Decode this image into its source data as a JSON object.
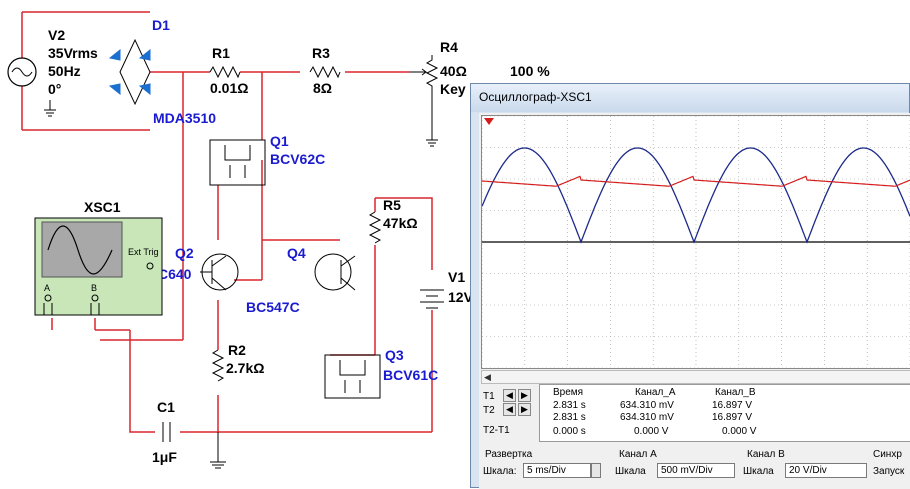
{
  "schematic": {
    "v2": {
      "name": "V2",
      "vrms": "35Vrms",
      "freq": "50Hz",
      "phase": "0°"
    },
    "d1": {
      "name": "D1",
      "model": "MDA3510"
    },
    "r1": {
      "name": "R1",
      "value": "0.01Ω"
    },
    "r3": {
      "name": "R3",
      "value": "8Ω"
    },
    "r4": {
      "name": "R4",
      "value": "40Ω",
      "key": "Key",
      "percent": "100 %"
    },
    "q1": {
      "name": "Q1",
      "model": "BCV62C"
    },
    "q2": {
      "name": "Q2",
      "model": "C640"
    },
    "q4": {
      "name": "Q4",
      "model": "BC547C"
    },
    "r5": {
      "name": "R5",
      "value": "47kΩ"
    },
    "v1": {
      "name": "V1",
      "value": "12V"
    },
    "r2": {
      "name": "R2",
      "value": "2.7kΩ"
    },
    "q3": {
      "name": "Q3",
      "model": "BCV61C"
    },
    "c1": {
      "name": "C1",
      "value": "1μF"
    },
    "xsc1": {
      "name": "XSC1",
      "ext_trig": "Ext Trig",
      "a": "A",
      "b": "B"
    }
  },
  "scope": {
    "title": "Осциллограф-XSC1",
    "cursor_labels": {
      "t1": "T1",
      "t2": "T2",
      "t2t1": "T2-T1"
    },
    "headers": {
      "time": "Время",
      "ch_a": "Канал_A",
      "ch_b": "Канал_B"
    },
    "rows": [
      {
        "time": "2.831 s",
        "a": "634.310 mV",
        "b": "16.897 V"
      },
      {
        "time": "2.831 s",
        "a": "634.310 mV",
        "b": "16.897 V"
      },
      {
        "time": "0.000 s",
        "a": "0.000 V",
        "b": "0.000 V"
      }
    ],
    "timebase": {
      "group": "Развертка",
      "label": "Шкала:",
      "value": "5 ms/Div"
    },
    "channel_a": {
      "group": "Канал A",
      "label": "Шкала",
      "value": "500 mV/Div"
    },
    "channel_b": {
      "group": "Канал B",
      "label": "Шкала",
      "value": "20  V/Div"
    },
    "trigger": {
      "group": "Синхр",
      "label": "Запуск"
    },
    "colors": {
      "channel_a": "#d41c1c",
      "channel_b": "#1c2a8c",
      "grid": "#9a9a9a"
    }
  }
}
